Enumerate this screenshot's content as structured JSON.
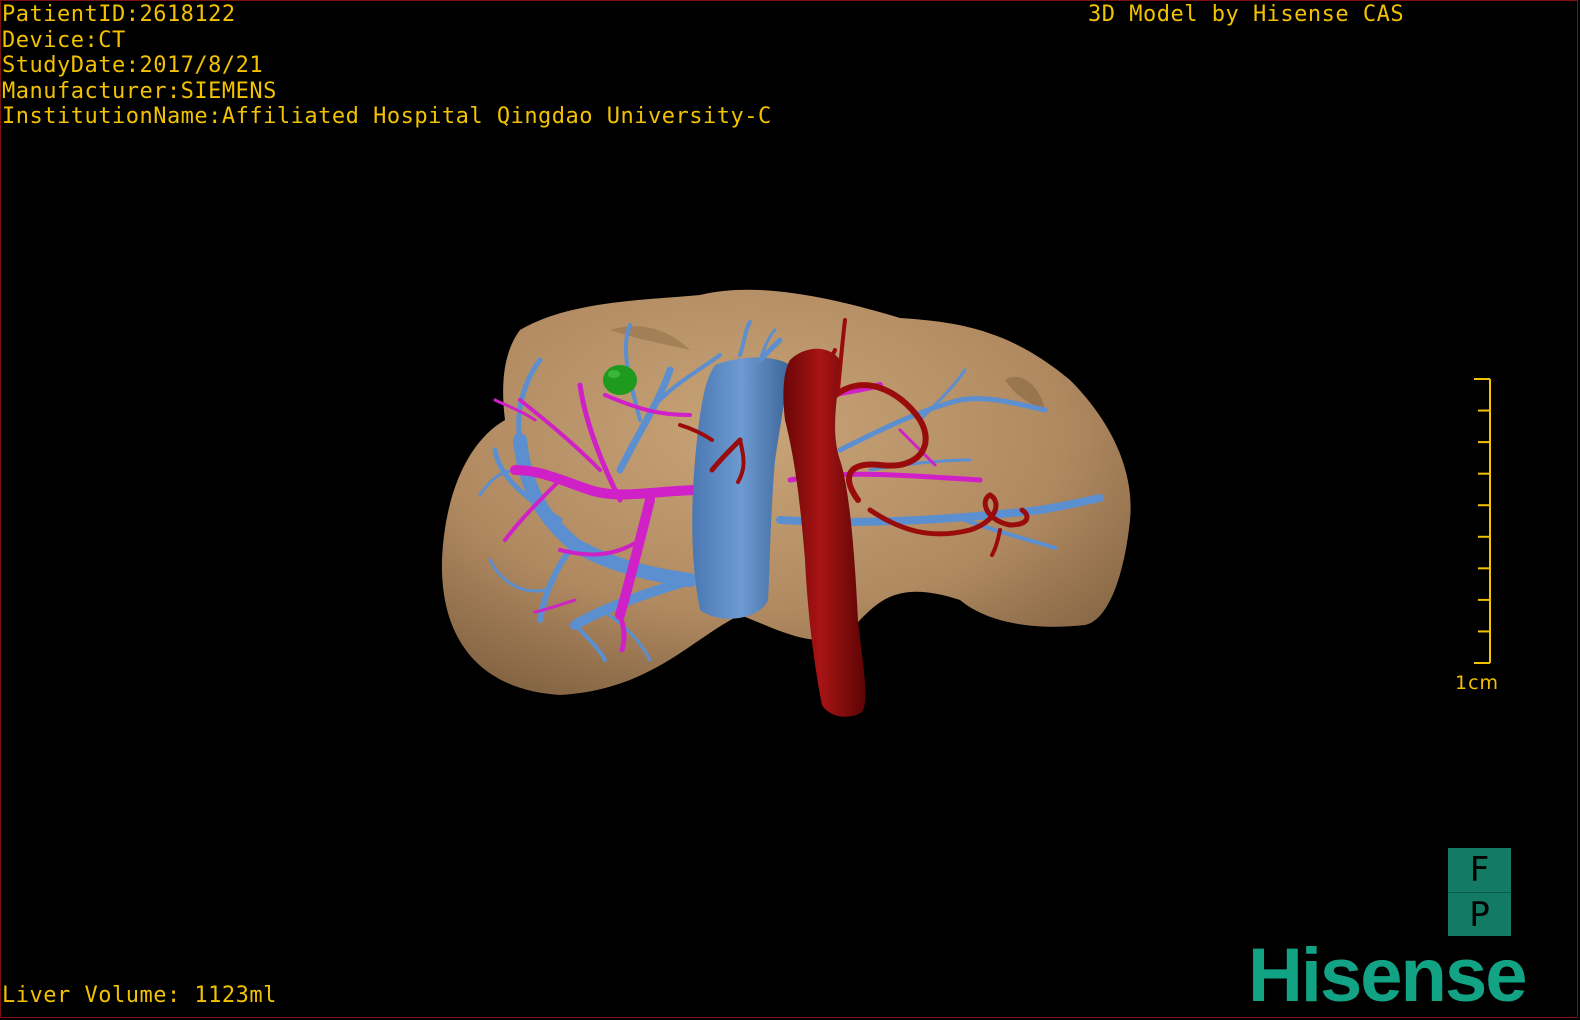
{
  "overlay": {
    "patient_id": "PatientID:2618122",
    "device": "Device:CT",
    "study_date": "StudyDate:2017/8/21",
    "manufacturer": "Manufacturer:SIEMENS",
    "institution": "InstitutionName:Affiliated Hospital Qingdao University-C",
    "credit": "3D Model by Hisense CAS",
    "liver_volume": "Liver Volume: 1123ml"
  },
  "scale": {
    "label": "1cm",
    "ticks": 10
  },
  "orientation": {
    "top": "F",
    "bottom": "P"
  },
  "brand": {
    "logo_text": "Hisense"
  },
  "colors": {
    "overlay_text": "#f2c200",
    "liver": "#b28c60",
    "portal_vein": "#5b8fd0",
    "hepatic_vein": "#d020c8",
    "artery_aorta": "#9a0c0c",
    "tumor": "#1e9a1e",
    "brand": "#12a385"
  }
}
